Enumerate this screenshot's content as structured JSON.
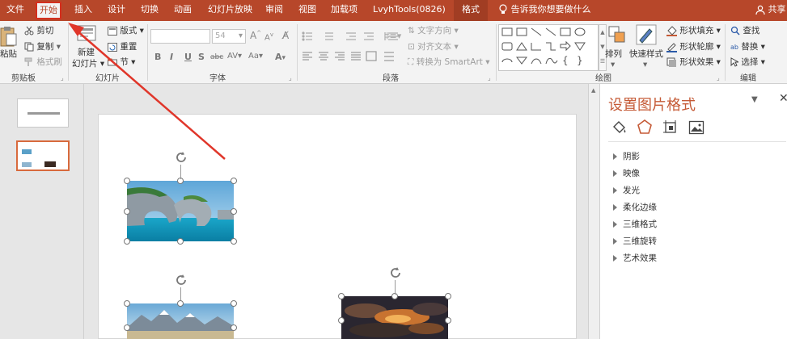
{
  "tabs": {
    "file": "文件",
    "home": "开始",
    "insert": "插入",
    "design": "设计",
    "transitions": "切换",
    "animations": "动画",
    "slideshow": "幻灯片放映",
    "review": "审阅",
    "view": "视图",
    "addins": "加载项",
    "lvyh": "LvyhTools(0826)",
    "format": "格式",
    "tellme": "告诉我你想要做什么",
    "share": "共享"
  },
  "ribbon": {
    "clipboard": {
      "paste": "粘贴",
      "cut": "剪切",
      "copy": "复制",
      "format_painter": "格式刷",
      "label": "剪贴板"
    },
    "slides": {
      "new_slide_1": "新建",
      "new_slide_2": "幻灯片",
      "layout": "版式",
      "reset": "重置",
      "section": "节",
      "label": "幻灯片"
    },
    "font": {
      "font_size": "54",
      "bold": "B",
      "italic": "I",
      "underline": "U",
      "shadow": "S",
      "strike": "abc",
      "spacing": "AV",
      "case": "Aa",
      "color": "A",
      "grow": "A",
      "shrink": "A",
      "label": "字体"
    },
    "paragraph": {
      "text_direction": "文字方向",
      "align_text": "对齐文本",
      "smartart": "转换为 SmartArt",
      "label": "段落"
    },
    "drawing": {
      "arrange": "排列",
      "quick_styles": "快速样式",
      "shape_fill": "形状填充",
      "shape_outline": "形状轮廓",
      "shape_effects": "形状效果",
      "label": "绘图"
    },
    "editing": {
      "find": "查找",
      "replace": "替换",
      "select": "选择",
      "label": "编辑"
    }
  },
  "pane": {
    "title": "设置图片格式",
    "items": [
      "阴影",
      "映像",
      "发光",
      "柔化边缘",
      "三维格式",
      "三维旋转",
      "艺术效果"
    ]
  },
  "colors": {
    "accent": "#b7472a",
    "annotation": "#e0362a",
    "pane_title": "#c55a36"
  }
}
